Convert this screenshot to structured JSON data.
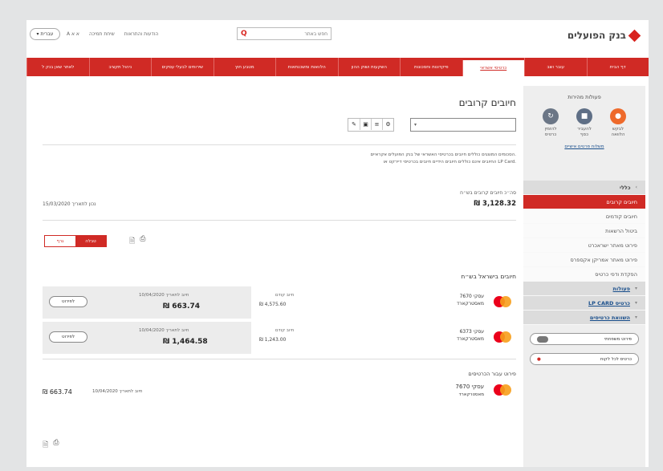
{
  "header": {
    "logo_text": "בנק הפועלים",
    "lang_button": "עברית",
    "util_links": [
      "A א א",
      "שיחת תמיכה",
      "הודעות והתראות"
    ],
    "search_placeholder": "חפש באתר"
  },
  "nav": {
    "tabs": [
      {
        "label": "דף הבית",
        "active": false
      },
      {
        "label": "עובר ושב",
        "active": false
      },
      {
        "label": "כרטיסי אשראי",
        "active": true
      },
      {
        "label": "פיקדונות וחסכונות",
        "active": false
      },
      {
        "label": "השקעות ושוק ההון",
        "active": false
      },
      {
        "label": "הלוואות ומשכנתאות",
        "active": false
      },
      {
        "label": "מטבע חוץ",
        "active": false
      },
      {
        "label": "שירותים לבעלי עסקים",
        "active": false
      },
      {
        "label": "ניהול תקציב",
        "active": false
      },
      {
        "label": "לאתר שאן בנק ל",
        "active": false
      }
    ]
  },
  "sidebar": {
    "quick_title": "פעולות מהירות",
    "quick_actions": [
      {
        "label": "לבקש הלוואה",
        "color": "#ee6a2b"
      },
      {
        "label": "להעביר כסף",
        "color": "#5f6f86"
      },
      {
        "label": "להזמין כרטיס",
        "color": "#6b7686"
      }
    ],
    "quick_link": "משלוח פרטים אישיים",
    "section_head": "כללי",
    "items": [
      {
        "label": "חיובים קרובים",
        "selected": true
      },
      {
        "label": "חיובים קודמים",
        "selected": false
      },
      {
        "label": "ביטול הרשאות",
        "selected": false
      },
      {
        "label": "פירוט מאתר ישראכרט",
        "selected": false
      },
      {
        "label": "פירוט מאתר אמריקן אקספרס",
        "selected": false
      },
      {
        "label": "הפקדת ודפי כרטיס",
        "selected": false
      }
    ],
    "groups": [
      "פעולות",
      "LP CARD כרטיס",
      "השוואת כרטיסים"
    ],
    "bottom_buttons": [
      "פירוט משפחתי",
      "כרטיס לכל לקוח"
    ]
  },
  "main": {
    "title": "חיובים קרובים",
    "dropdown_text": "",
    "notice_lines": [
      "הסכומים המוצגים כוללים חיובים בכרטיסי האשראי של בנק הפועלים אקראיים.",
      "החיובים אינם כוללים חיובים הידיים חיובים בכרטיסי דיירקט או LP Card."
    ],
    "total_label": "סה״כ חיובים קרובים בש״ח",
    "total_amount": "₪ 3,128.32",
    "date_line": "נכון לתאריך 15/03/2020",
    "view_toggle": {
      "on": "טבלה",
      "off": "גרף"
    },
    "section_title": "חיובים בישראל בש״ח",
    "rows": [
      {
        "card_name": "7670 עסקי",
        "card_type": "מאסטרקארד",
        "credit_label": "חיוב קודם",
        "credit_amount": "₪ 4,575.60",
        "date_label": "10/04/2020 חיוב לתאריך",
        "amount": "₪ 663.74",
        "button": "לפירוט"
      },
      {
        "card_name": "6373 עסקי",
        "card_type": "מאסטרקארד",
        "credit_label": "חיוב קודם",
        "credit_amount": "₪ 1,243.00",
        "date_label": "10/04/2020 חיוב לתאריך",
        "amount": "₪ 1,464.58",
        "button": "לפירוט"
      }
    ],
    "payments_title": "פירוט עבור הכרטיסים",
    "payment": {
      "card_name": "7670 עסקי",
      "card_type": "מאסטרקארד",
      "date_label": "10/04/2020 חיוב לתאריך",
      "amount": "₪ 663.74"
    }
  },
  "icons": [
    "print-icon",
    "pdf-icon",
    "search-icon",
    "chevron-down-icon",
    "mastercard-icon"
  ]
}
